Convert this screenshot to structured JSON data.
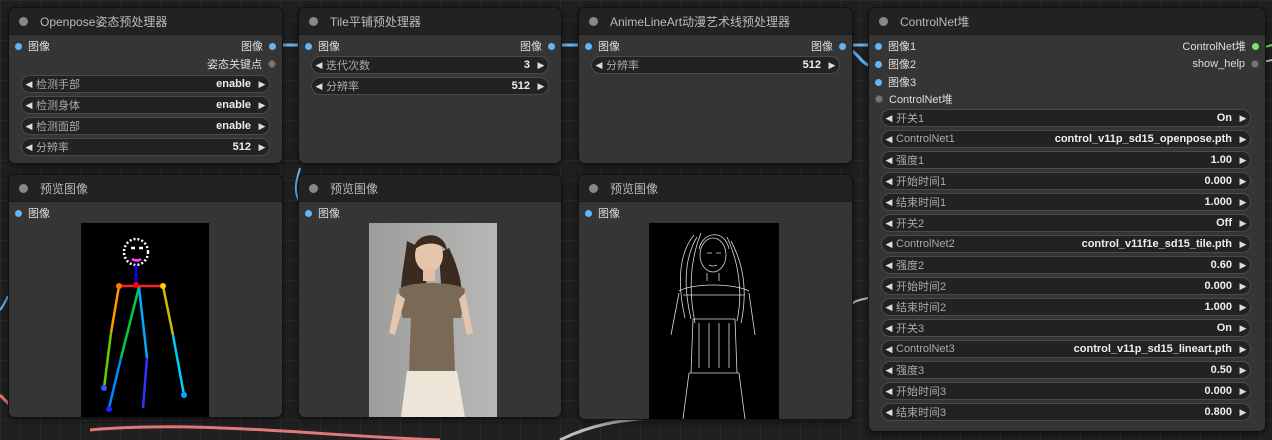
{
  "colors": {
    "canvas_bg": "#202020",
    "node_bg": "#353535",
    "title_bg": "#222222",
    "image_slot": "#64b5f6",
    "active_output": "#7ee36e"
  },
  "openpose_node": {
    "title": "Openpose姿态预处理器",
    "input_label": "图像",
    "output_image_label": "图像",
    "output_keypoints_label": "姿态关键点",
    "widgets": [
      {
        "label": "检测手部",
        "value": "enable"
      },
      {
        "label": "检测身体",
        "value": "enable"
      },
      {
        "label": "检测面部",
        "value": "enable"
      },
      {
        "label": "分辨率",
        "value": "512"
      }
    ]
  },
  "tile_node": {
    "title": "Tile平铺预处理器",
    "input_label": "图像",
    "output_label": "图像",
    "widgets": [
      {
        "label": "迭代次数",
        "value": "3"
      },
      {
        "label": "分辨率",
        "value": "512"
      }
    ]
  },
  "lineart_node": {
    "title": "AnimeLineArt动漫艺术线预处理器",
    "input_label": "图像",
    "output_label": "图像",
    "widgets": [
      {
        "label": "分辨率",
        "value": "512"
      }
    ]
  },
  "preview_nodes": [
    {
      "title": "预览图像",
      "input_label": "图像"
    },
    {
      "title": "预览图像",
      "input_label": "图像"
    },
    {
      "title": "预览图像",
      "input_label": "图像"
    }
  ],
  "controlnet_stack": {
    "title": "ControlNet堆",
    "inputs": [
      "图像1",
      "图像2",
      "图像3",
      "ControlNet堆"
    ],
    "outputs": [
      "ControlNet堆",
      "show_help"
    ],
    "widgets": [
      {
        "label": "开关1",
        "value": "On"
      },
      {
        "label": "ControlNet1",
        "value": "control_v11p_sd15_openpose.pth"
      },
      {
        "label": "强度1",
        "value": "1.00"
      },
      {
        "label": "开始时间1",
        "value": "0.000"
      },
      {
        "label": "结束时间1",
        "value": "1.000"
      },
      {
        "label": "开关2",
        "value": "Off"
      },
      {
        "label": "ControlNet2",
        "value": "control_v11f1e_sd15_tile.pth"
      },
      {
        "label": "强度2",
        "value": "0.60"
      },
      {
        "label": "开始时间2",
        "value": "0.000"
      },
      {
        "label": "结束时间2",
        "value": "1.000"
      },
      {
        "label": "开关3",
        "value": "On"
      },
      {
        "label": "ControlNet3",
        "value": "control_v11p_sd15_lineart.pth"
      },
      {
        "label": "强度3",
        "value": "0.50"
      },
      {
        "label": "开始时间3",
        "value": "0.000"
      },
      {
        "label": "结束时间3",
        "value": "0.800"
      }
    ]
  }
}
